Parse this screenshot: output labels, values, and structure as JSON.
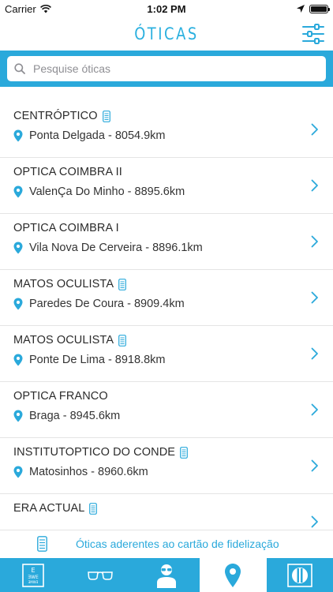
{
  "status_bar": {
    "carrier": "Carrier",
    "time": "1:02 PM"
  },
  "nav": {
    "title": "ÓTICAS"
  },
  "search": {
    "placeholder": "Pesquise óticas"
  },
  "colors": {
    "accent": "#2aa9db",
    "text": "#2b2b2b"
  },
  "items": [
    {
      "name": "CENTRÓPTICO",
      "location": "Ponta Delgada - 8054.9km",
      "card": true
    },
    {
      "name": "OPTICA COIMBRA II",
      "location": "ValenÇa Do Minho - 8895.6km",
      "card": false
    },
    {
      "name": "OPTICA COIMBRA I",
      "location": "Vila Nova De Cerveira - 8896.1km",
      "card": false
    },
    {
      "name": "MATOS OCULISTA",
      "location": "Paredes De Coura - 8909.4km",
      "card": true
    },
    {
      "name": "MATOS OCULISTA",
      "location": "Ponte De Lima - 8918.8km",
      "card": true
    },
    {
      "name": "OPTICA FRANCO",
      "location": "Braga - 8945.6km",
      "card": false
    },
    {
      "name": "INSTITUTOPTICO DO CONDE",
      "location": "Matosinhos - 8960.6km",
      "card": true
    },
    {
      "name": "ERA ACTUAL",
      "location": "",
      "card": true
    }
  ],
  "fidelity": {
    "label": "Óticas aderentes ao cartão de fidelização",
    "icon": "card-icon"
  },
  "tabs": [
    {
      "icon": "eye-chart-icon",
      "active": false
    },
    {
      "icon": "glasses-icon",
      "active": false
    },
    {
      "icon": "optician-person-icon",
      "active": false
    },
    {
      "icon": "location-pin-icon",
      "active": true
    },
    {
      "icon": "brand-logo-icon",
      "active": false
    }
  ]
}
